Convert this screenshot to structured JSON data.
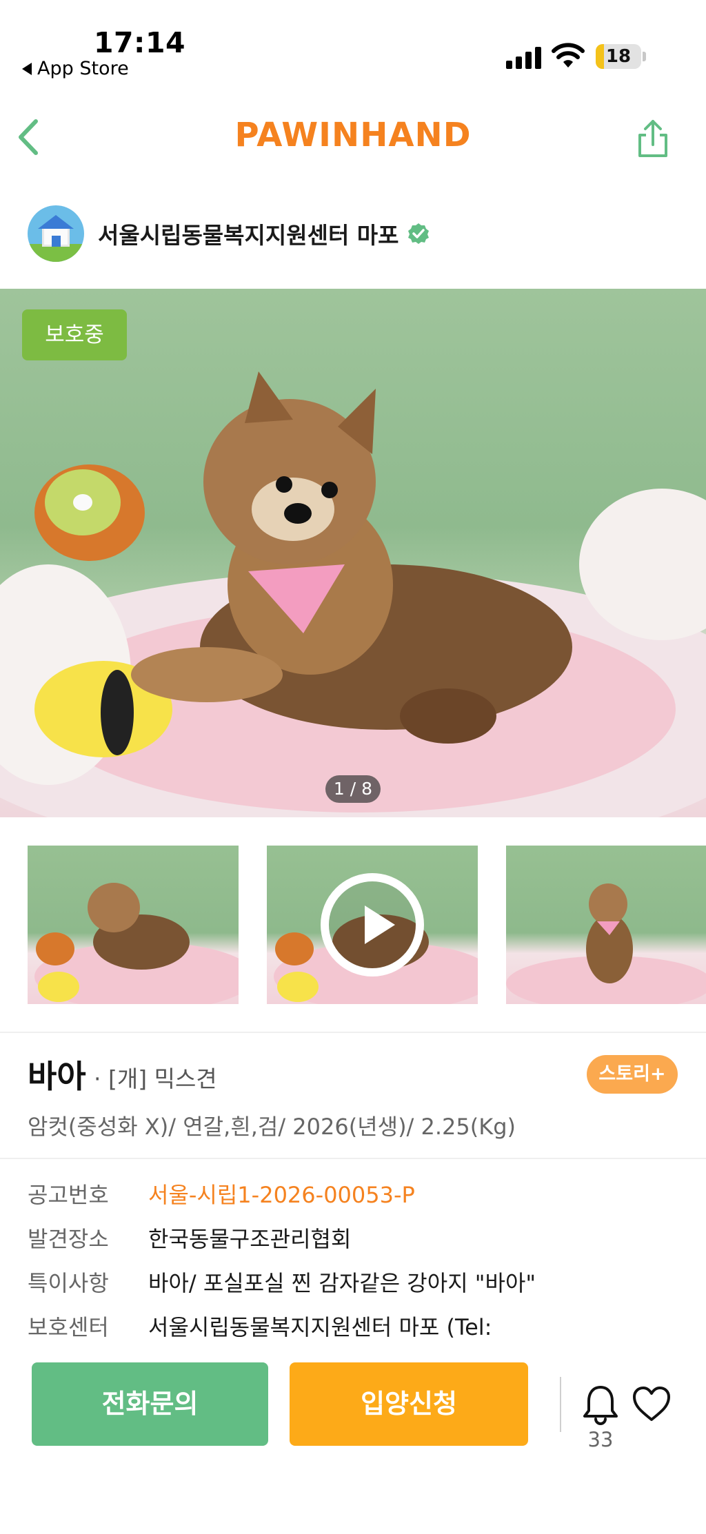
{
  "status_bar": {
    "time": "17:14",
    "back_app": "App Store",
    "battery_level": "18",
    "battery_fraction": 0.18
  },
  "nav": {
    "brand": "PAWINHAND",
    "back_icon": "chevron-left-icon",
    "share_icon": "share-icon",
    "accent_color": "#62bd84"
  },
  "shelter": {
    "name": "서울시립동물복지지원센터 마포",
    "verified_icon": "verified-check-icon"
  },
  "photo": {
    "status_tag": "보호중",
    "page_counter": "1 / 8",
    "description_icon": "dog-photo"
  },
  "thumbnails": [
    {
      "kind": "photo"
    },
    {
      "kind": "video",
      "icon": "play-icon"
    },
    {
      "kind": "photo"
    }
  ],
  "pet": {
    "name": "바아",
    "breed": "· [개] 믹스견",
    "story_label": "스토리+",
    "attributes": "암컷(중성화 X)/ 연갈,흰,검/ 2026(년생)/ 2.25(Kg)"
  },
  "info": {
    "notice_no_label": "공고번호",
    "notice_no": "서울-시립1-2026-00053-P",
    "found_place_label": "발견장소",
    "found_place": "한국동물구조관리협회",
    "notes_label": "특이사항",
    "notes": "바아/  포실포실 찐 감자같은 강아지 \"바아\"",
    "center_label": "보호센터",
    "center": "서울시립동물복지지원센터 마포 (Tel:"
  },
  "actions": {
    "call_label": "전화문의",
    "adopt_label": "입양신청",
    "bell_count": "33",
    "call_color": "#62bd84",
    "adopt_color": "#fdaa18",
    "brand_color": "#f5821f"
  }
}
